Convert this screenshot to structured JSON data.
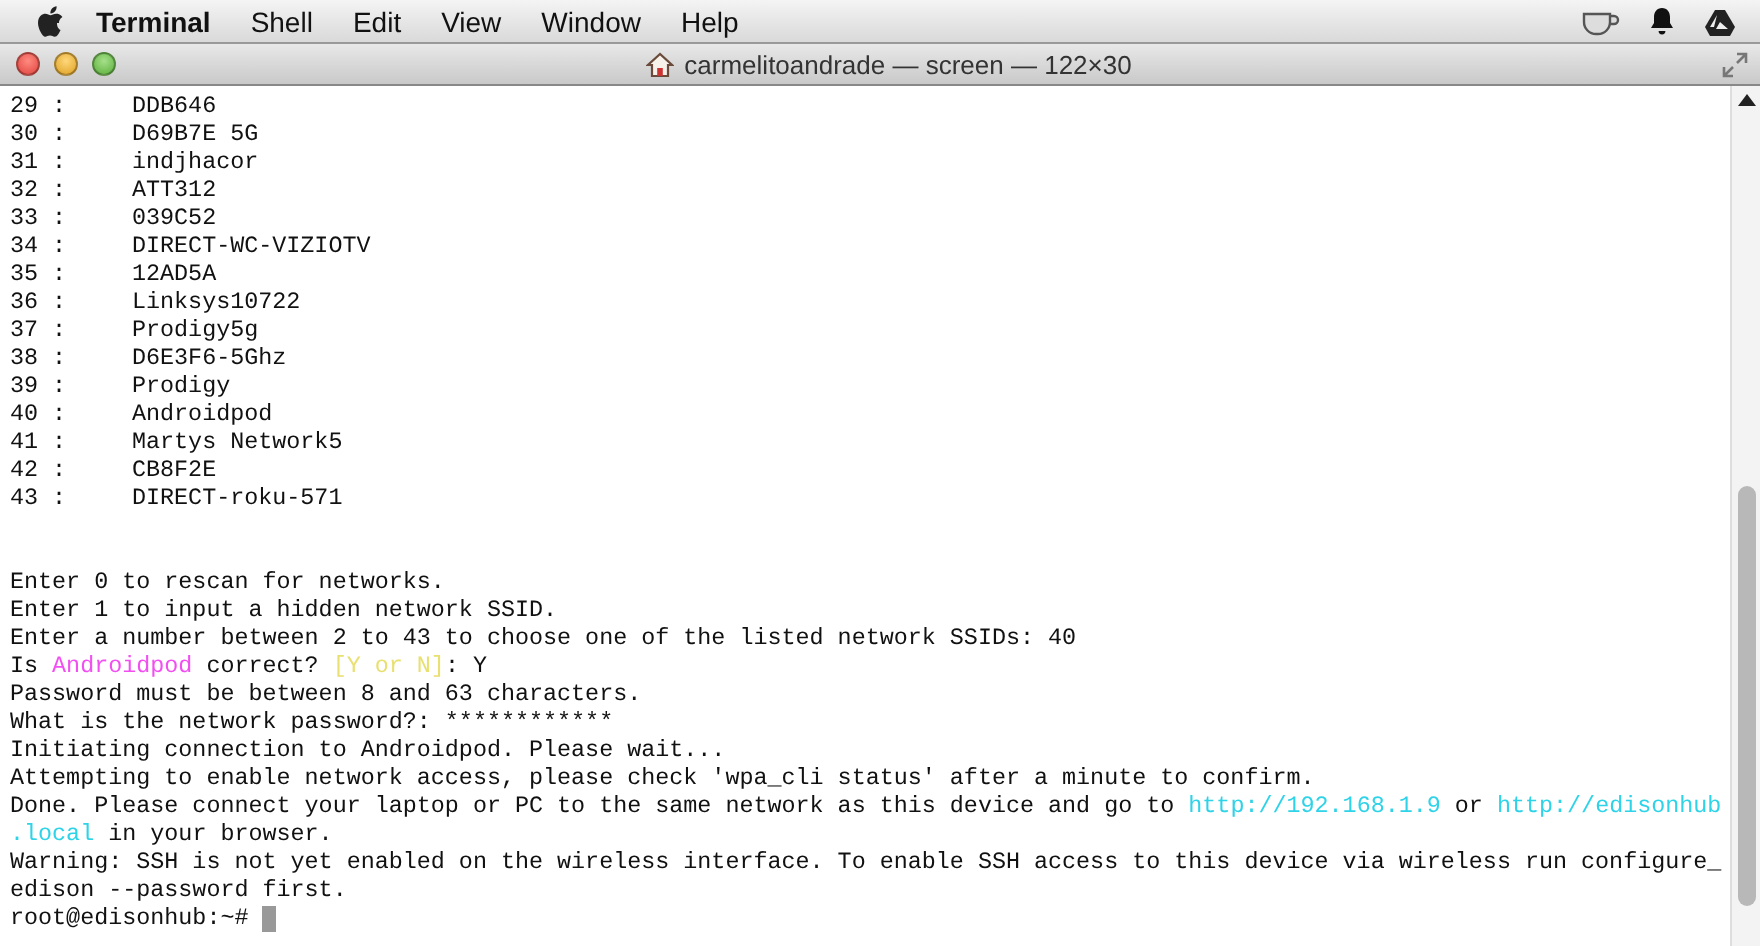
{
  "menu_bar": {
    "app_name": "Terminal",
    "items": [
      "Shell",
      "Edit",
      "View",
      "Window",
      "Help"
    ]
  },
  "window": {
    "title": "carmelitoandrade — screen — 122×30"
  },
  "networks": [
    {
      "number": "29 :",
      "ssid": "DDB646"
    },
    {
      "number": "30 :",
      "ssid": "D69B7E 5G"
    },
    {
      "number": "31 :",
      "ssid": "indjhacor"
    },
    {
      "number": "32 :",
      "ssid": "ATT312"
    },
    {
      "number": "33 :",
      "ssid": "039C52"
    },
    {
      "number": "34 :",
      "ssid": "DIRECT-WC-VIZIOTV"
    },
    {
      "number": "35 :",
      "ssid": "12AD5A"
    },
    {
      "number": "36 :",
      "ssid": "Linksys10722"
    },
    {
      "number": "37 :",
      "ssid": "Prodigy5g"
    },
    {
      "number": "38 :",
      "ssid": "D6E3F6-5Ghz"
    },
    {
      "number": "39 :",
      "ssid": "Prodigy"
    },
    {
      "number": "40 :",
      "ssid": "Androidpod"
    },
    {
      "number": "41 :",
      "ssid": "Martys Network5"
    },
    {
      "number": "42 :",
      "ssid": "CB8F2E"
    },
    {
      "number": "43 :",
      "ssid": "DIRECT-roku-571"
    }
  ],
  "output": [
    {
      "parts": [
        {
          "kind": "plain",
          "text": "Enter 0 to rescan for networks."
        }
      ]
    },
    {
      "parts": [
        {
          "kind": "plain",
          "text": "Enter 1 to input a hidden network SSID."
        }
      ]
    },
    {
      "parts": [
        {
          "kind": "plain",
          "text": "Enter a number between 2 to 43 to choose one of the listed network SSIDs: 40"
        }
      ]
    },
    {
      "parts": [
        {
          "kind": "plain",
          "text": "Is "
        },
        {
          "kind": "ssid",
          "text": "Androidpod"
        },
        {
          "kind": "plain",
          "text": " correct? "
        },
        {
          "kind": "prompt",
          "text": "[Y or N]"
        },
        {
          "kind": "plain",
          "text": ": Y"
        }
      ]
    },
    {
      "parts": [
        {
          "kind": "plain",
          "text": "Password must be between 8 and 63 characters."
        }
      ]
    },
    {
      "parts": [
        {
          "kind": "plain",
          "text": "What is the network password?: ************"
        }
      ]
    },
    {
      "parts": [
        {
          "kind": "plain",
          "text": "Initiating connection to Androidpod. Please wait..."
        }
      ]
    },
    {
      "parts": [
        {
          "kind": "plain",
          "text": "Attempting to enable network access, please check 'wpa_cli status' after a minute to confirm."
        }
      ]
    },
    {
      "parts": [
        {
          "kind": "plain",
          "text": "Done. Please connect your laptop or PC to the same network as this device and go to "
        },
        {
          "kind": "link",
          "text": "http://192.168.1.9"
        },
        {
          "kind": "plain",
          "text": " or "
        },
        {
          "kind": "link",
          "text": "http://edisonhub"
        }
      ]
    },
    {
      "parts": [
        {
          "kind": "link",
          "text": ".local"
        },
        {
          "kind": "plain",
          "text": " in your browser."
        }
      ]
    },
    {
      "parts": [
        {
          "kind": "plain",
          "text": "Warning: SSH is not yet enabled on the wireless interface. To enable SSH access to this device via wireless run configure_"
        }
      ]
    },
    {
      "parts": [
        {
          "kind": "plain",
          "text": "edison --password first."
        }
      ]
    }
  ],
  "prompt": "root@edisonhub:~#"
}
